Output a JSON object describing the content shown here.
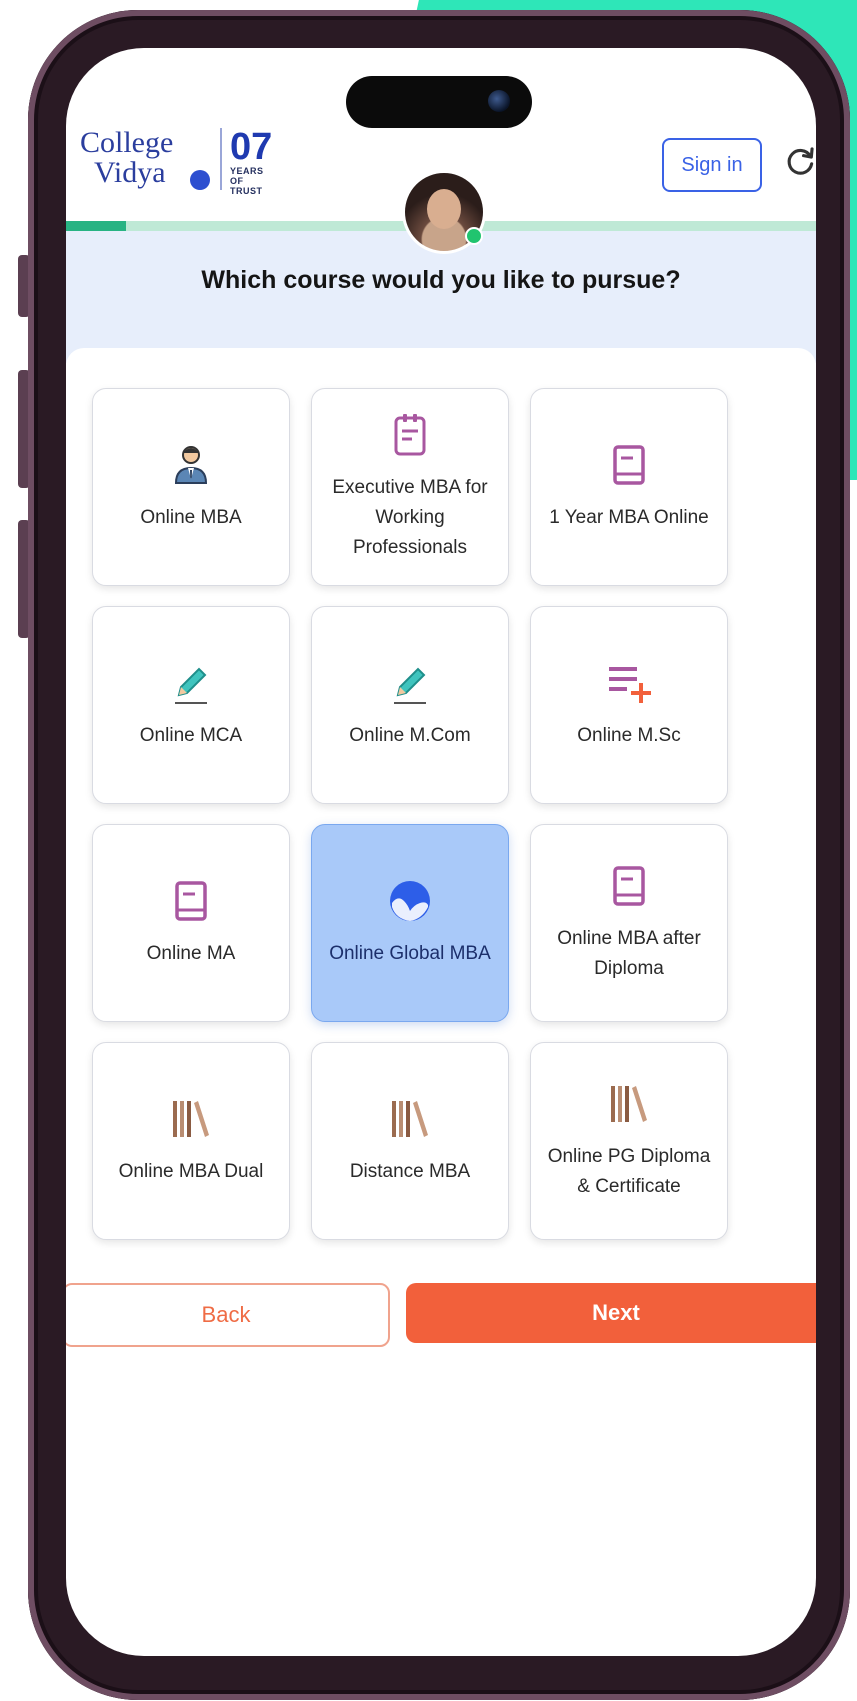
{
  "brand": {
    "logo_line1": "College",
    "logo_line2": "Vidya",
    "years_number": "07",
    "years_text_1": "YEARS OF",
    "years_text_2": "TRUST"
  },
  "header": {
    "signin_label": "Sign in",
    "progress_fraction": 0.08
  },
  "question": "Which course would you like to pursue?",
  "courses": [
    {
      "label": "Online MBA",
      "icon": "businessman-icon",
      "selected": false
    },
    {
      "label": "Executive MBA for Working Professionals",
      "icon": "clipboard-icon",
      "selected": false
    },
    {
      "label": "1 Year MBA Online",
      "icon": "book-icon",
      "selected": false
    },
    {
      "label": "Online MCA",
      "icon": "pencil-icon",
      "selected": false
    },
    {
      "label": "Online M.Com",
      "icon": "pencil-icon",
      "selected": false
    },
    {
      "label": "Online M.Sc",
      "icon": "list-add-icon",
      "selected": false
    },
    {
      "label": "Online MA",
      "icon": "book-icon",
      "selected": false
    },
    {
      "label": "Online Global MBA",
      "icon": "globe-icon",
      "selected": true
    },
    {
      "label": "Online MBA after Diploma",
      "icon": "book-icon",
      "selected": false
    },
    {
      "label": "Online MBA Dual",
      "icon": "library-books-icon",
      "selected": false
    },
    {
      "label": "Distance MBA",
      "icon": "library-books-icon",
      "selected": false
    },
    {
      "label": "Online PG Diploma & Certificate",
      "icon": "library-books-icon",
      "selected": false
    }
  ],
  "actions": {
    "back_label": "Back",
    "next_label": "Next"
  },
  "colors": {
    "accent_blue": "#3a62e6",
    "selected_card": "#a9c9f9",
    "next_button": "#f2603b",
    "progress": "#28b383",
    "device_accent": "#2ee6b8"
  }
}
